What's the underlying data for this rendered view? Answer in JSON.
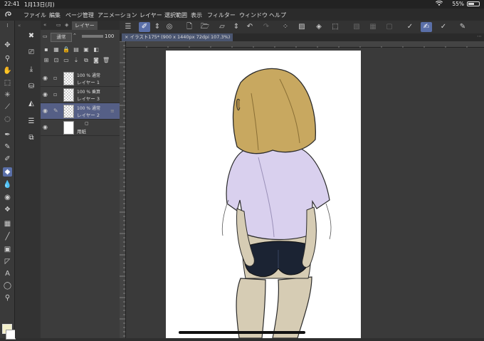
{
  "status": {
    "time": "22:41",
    "date": "1月13日(月)",
    "wifi_icon": "wifi-icon",
    "battery": "55%",
    "battery_level": 0.55
  },
  "menu": {
    "items": [
      "ファイル",
      "編集",
      "ページ管理",
      "アニメーション",
      "レイヤー",
      "選択範囲",
      "表示",
      "フィルター",
      "ウィンドウ",
      "ヘルプ"
    ]
  },
  "layer_panel": {
    "tabs": [
      "レイヤー"
    ],
    "blend_mode": "通常",
    "opacity": "100",
    "layers": [
      {
        "mode": "100 % 通常",
        "name": "レイヤー 1",
        "visible": true,
        "selected": false,
        "thumb": "transparent"
      },
      {
        "mode": "100 % 乗算",
        "name": "レイヤー 3",
        "visible": true,
        "selected": false,
        "thumb": "transparent"
      },
      {
        "mode": "100 % 通常",
        "name": "レイヤー 2",
        "visible": true,
        "selected": true,
        "thumb": "transparent"
      },
      {
        "mode": "",
        "name": "用紙",
        "visible": true,
        "selected": false,
        "thumb": "white"
      }
    ]
  },
  "document": {
    "tab_title": "イラスト175* (900 x 1440px 72dpi 107.3%)"
  },
  "colors": {
    "accent": "#5a6fa8",
    "main_color": "#f3efc9",
    "sub_color": "#ffffff",
    "hair": "#c8a860",
    "shirt": "#d9d0ee",
    "shorts": "#1b2333",
    "skin": "#d6ccb4"
  }
}
